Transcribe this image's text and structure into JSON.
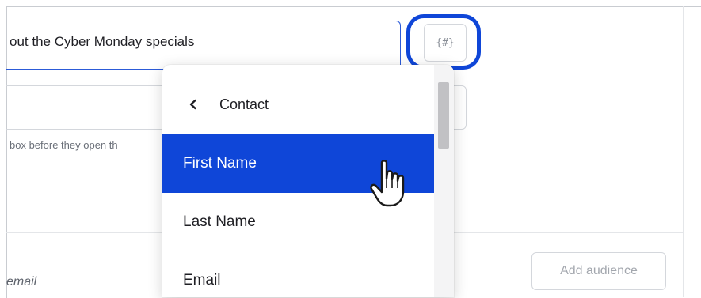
{
  "subject": {
    "value": "out the Cyber Monday specials",
    "merge_tag_label": "{#}"
  },
  "preview": {
    "hint": "box before they open th"
  },
  "audience": {
    "label": "email",
    "add_button": "Add audience"
  },
  "dropdown": {
    "header": "Contact",
    "items": [
      {
        "label": "First Name",
        "active": true
      },
      {
        "label": "Last Name",
        "active": false
      },
      {
        "label": "Email",
        "active": false
      }
    ]
  },
  "colors": {
    "accent": "#0f46d8",
    "input_focus": "#2c5bd8",
    "border": "#d4d7dc"
  },
  "icons": {
    "back": "chevron-left-icon",
    "cursor": "hand-pointer-icon"
  }
}
